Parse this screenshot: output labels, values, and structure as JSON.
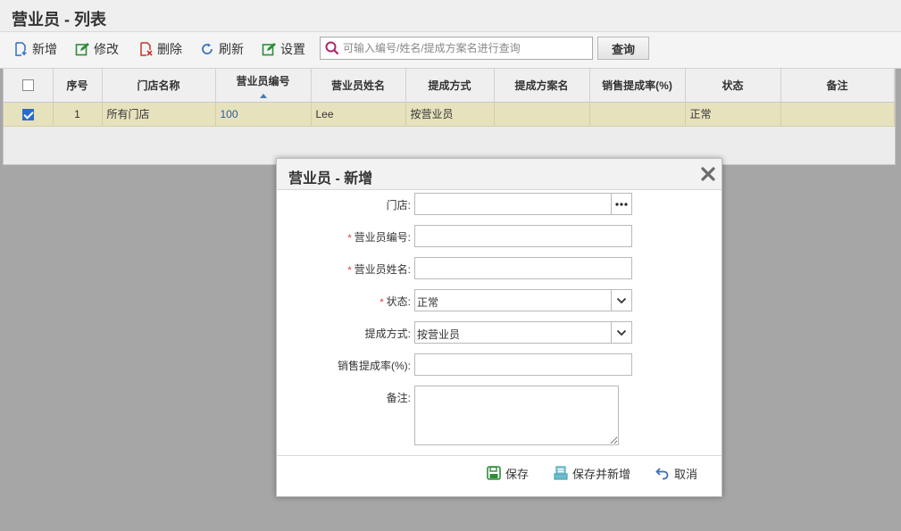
{
  "page": {
    "title": "营业员 - 列表"
  },
  "toolbar": {
    "add_label": "新增",
    "edit_label": "修改",
    "delete_label": "删除",
    "refresh_label": "刷新",
    "settings_label": "设置",
    "search_placeholder": "可输入编号/姓名/提成方案名进行查询",
    "query_label": "查询"
  },
  "grid": {
    "columns": [
      "序号",
      "门店名称",
      "营业员编号",
      "营业员姓名",
      "提成方式",
      "提成方案名",
      "销售提成率(%)",
      "状态",
      "备注"
    ],
    "rows": [
      {
        "checked": true,
        "seq": "1",
        "store": "所有门店",
        "code": "100",
        "name": "Lee",
        "method": "按营业员",
        "plan": "",
        "rate": "",
        "status": "正常",
        "remark": ""
      }
    ]
  },
  "dialog": {
    "title": "营业员 - 新增",
    "fields": {
      "store_label": "门店:",
      "code_label": "营业员编号:",
      "name_label": "营业员姓名:",
      "status_label": "状态:",
      "status_value": "正常",
      "method_label": "提成方式:",
      "method_value": "按营业员",
      "rate_label": "销售提成率(%):",
      "remark_label": "备注:",
      "required_mark": "*"
    },
    "buttons": {
      "save": "保存",
      "save_new": "保存并新增",
      "cancel": "取消"
    }
  },
  "colors": {
    "selected_row": "#e6e2bd",
    "link": "#2a5b9a",
    "required": "#e0342b",
    "accent": "#2a6cc7"
  }
}
